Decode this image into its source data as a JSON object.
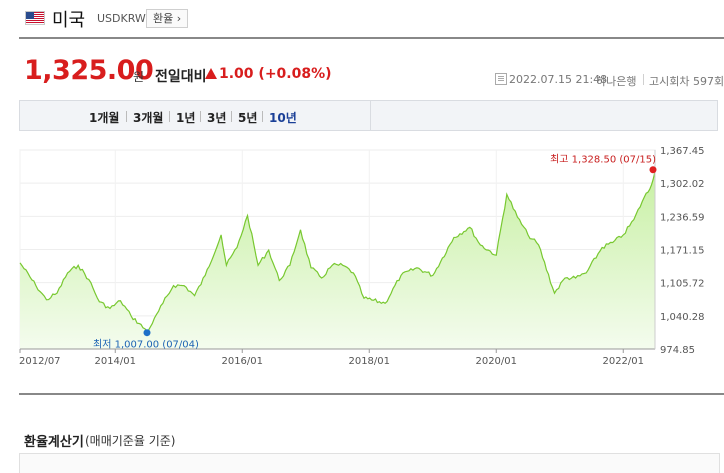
{
  "header": {
    "country": "미국",
    "code": "USDKRW",
    "exchange_button": "환율 ›",
    "flag_icon": "us-flag-icon"
  },
  "quote": {
    "price": "1,325.00",
    "unit": "원",
    "change_label": "전일대비",
    "change_value": "1.00 (+0.08%)",
    "direction": "up",
    "timestamp": "2022.07.15 21:48",
    "source": "하나은행",
    "notice": "고시회차 597회"
  },
  "tabs": [
    {
      "label": "1개월",
      "active": false
    },
    {
      "label": "3개월",
      "active": false
    },
    {
      "label": "1년",
      "active": false
    },
    {
      "label": "3년",
      "active": false
    },
    {
      "label": "5년",
      "active": false
    },
    {
      "label": "10년",
      "active": true
    }
  ],
  "colors": {
    "up": "#d81d1d",
    "active_tab": "#1a3f97",
    "line": "#78c830",
    "area_top": "#c8f0a4",
    "area_bottom": "#f4fcee",
    "max_marker": "#e02020",
    "min_marker": "#1e70c8",
    "max_label": "#c81e1e",
    "min_label": "#1e64b4"
  },
  "chart_data": {
    "type": "area",
    "xlim": [
      "2012/07",
      "2022/07"
    ],
    "ylim": [
      974.85,
      1367.45
    ],
    "x_tick_labels": [
      "2012/07",
      "2014/01",
      "2016/01",
      "2018/01",
      "2020/01",
      "2022/01"
    ],
    "y_tick_labels": [
      "1,367.45",
      "1,302.02",
      "1,236.59",
      "1,171.15",
      "1,105.72",
      "1,040.28",
      "974.85"
    ],
    "grid": true,
    "series": [
      {
        "points": [
          [
            "2012/07",
            1145
          ],
          [
            "2012/10",
            1100
          ],
          [
            "2012/12",
            1072
          ],
          [
            "2013/02",
            1085
          ],
          [
            "2013/04",
            1125
          ],
          [
            "2013/06",
            1140
          ],
          [
            "2013/08",
            1112
          ],
          [
            "2013/10",
            1068
          ],
          [
            "2013/12",
            1055
          ],
          [
            "2014/02",
            1070
          ],
          [
            "2014/04",
            1040
          ],
          [
            "2014/07",
            1010
          ],
          [
            "2014/08",
            1025
          ],
          [
            "2014/10",
            1065
          ],
          [
            "2014/12",
            1100
          ],
          [
            "2015/02",
            1100
          ],
          [
            "2015/04",
            1080
          ],
          [
            "2015/06",
            1120
          ],
          [
            "2015/09",
            1200
          ],
          [
            "2015/10",
            1140
          ],
          [
            "2015/12",
            1175
          ],
          [
            "2016/02",
            1238
          ],
          [
            "2016/04",
            1140
          ],
          [
            "2016/06",
            1170
          ],
          [
            "2016/08",
            1110
          ],
          [
            "2016/10",
            1140
          ],
          [
            "2016/12",
            1210
          ],
          [
            "2017/02",
            1135
          ],
          [
            "2017/04",
            1115
          ],
          [
            "2017/06",
            1140
          ],
          [
            "2017/08",
            1140
          ],
          [
            "2017/10",
            1125
          ],
          [
            "2017/12",
            1075
          ],
          [
            "2018/04",
            1065
          ],
          [
            "2018/07",
            1120
          ],
          [
            "2018/10",
            1135
          ],
          [
            "2019/01",
            1120
          ],
          [
            "2019/05",
            1195
          ],
          [
            "2019/08",
            1215
          ],
          [
            "2019/10",
            1180
          ],
          [
            "2020/01",
            1160
          ],
          [
            "2020/03",
            1280
          ],
          [
            "2020/05",
            1235
          ],
          [
            "2020/07",
            1200
          ],
          [
            "2020/09",
            1180
          ],
          [
            "2020/12",
            1085
          ],
          [
            "2021/02",
            1115
          ],
          [
            "2021/04",
            1115
          ],
          [
            "2021/06",
            1125
          ],
          [
            "2021/09",
            1175
          ],
          [
            "2021/11",
            1185
          ],
          [
            "2022/01",
            1200
          ],
          [
            "2022/03",
            1230
          ],
          [
            "2022/05",
            1275
          ],
          [
            "2022/06",
            1290
          ],
          [
            "2022/07",
            1325
          ]
        ]
      }
    ],
    "annotations": [
      {
        "label": "최고 1,328.50 (07/15)",
        "x": "2022/07",
        "y": 1328.5
      },
      {
        "label": "최저 1,007.00 (07/04)",
        "x": "2014/07",
        "y": 1007.0
      }
    ]
  },
  "calculator": {
    "title": "환율계산기",
    "subtitle": "(매매기준율 기준)"
  }
}
